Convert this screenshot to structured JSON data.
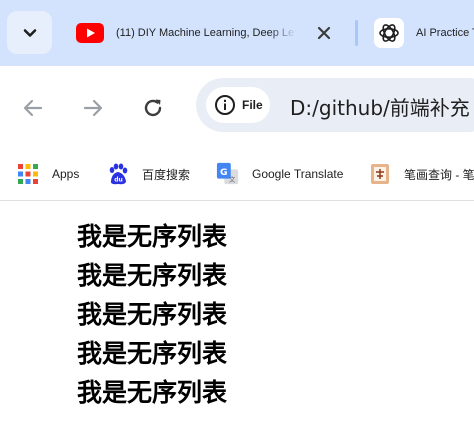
{
  "tabs": [
    {
      "title": "(11) DIY Machine Learning, Deep Le",
      "icon": "youtube-icon"
    },
    {
      "title": "AI Practice T",
      "icon": "openai-icon"
    }
  ],
  "toolbar": {
    "site_chip_label": "File",
    "url": "D:/github/前端补充"
  },
  "bookmarks": [
    {
      "label": "Apps",
      "icon": "apps-grid-icon"
    },
    {
      "label": "百度搜索",
      "icon": "baidu-paw-icon"
    },
    {
      "label": "Google Translate",
      "icon": "google-translate-icon"
    },
    {
      "label": "笔画查询 - 笔",
      "icon": "bihua-icon"
    }
  ],
  "page": {
    "list_items": [
      "我是无序列表",
      "我是无序列表",
      "我是无序列表",
      "我是无序列表",
      "我是无序列表"
    ]
  },
  "colors": {
    "tabstrip_bg": "#d3e3fd",
    "omnibox_bg": "#e9eef6",
    "youtube_red": "#ff0000"
  }
}
